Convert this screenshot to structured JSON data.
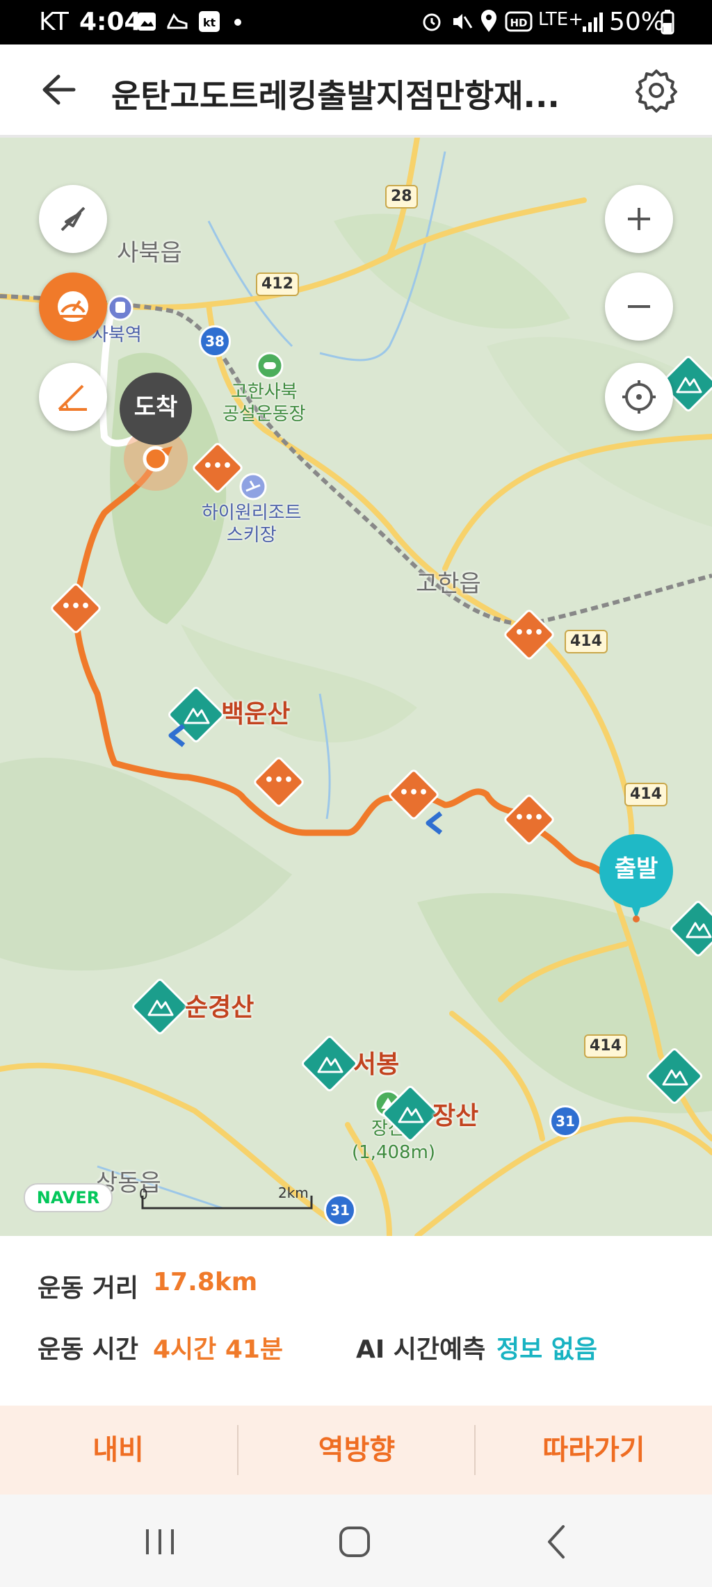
{
  "status_bar": {
    "carrier": "KT",
    "time": "4:04",
    "network": "LTE+",
    "battery": "50%"
  },
  "header": {
    "title": "운탄고도트레킹출발지점만항재..."
  },
  "map": {
    "labels": {
      "sabuk_town": "사북읍",
      "sabuk_station": "사북역",
      "gohan_sabuk_field": "고한사북\n공설운동장",
      "high1_resort": "하이원리조트\n스키장",
      "gohan_town": "고한읍",
      "baegunsan": "백운산",
      "sungyeongsan": "순경산",
      "seobong": "서봉",
      "jangsan": "장산",
      "jangsan_small": "장산",
      "jangsan_elev": "(1,408m)",
      "sangdong_town": "상동읍"
    },
    "roads": {
      "r28": "28",
      "r412": "412",
      "r38": "38",
      "r414a": "414",
      "r414b": "414",
      "r414c": "414",
      "r31a": "31",
      "r31b": "31"
    },
    "pins": {
      "arrive": "도착",
      "start": "출발"
    },
    "scale": {
      "zero": "0",
      "distance": "2km"
    },
    "logo": "NAVER",
    "icons": {
      "zoom_in": "plus-icon",
      "zoom_out": "minus-icon",
      "locate": "crosshair-icon",
      "compass": "compass-off-icon",
      "speed": "speedometer-icon",
      "slope": "slope-icon"
    }
  },
  "info": {
    "distance_label": "운동 거리",
    "distance_value": "17.8km",
    "time_label": "운동 시간",
    "time_value": "4시간 41분",
    "ai_label": "AI 시간예측",
    "ai_value": "정보 없음"
  },
  "actions": {
    "navi": "내비",
    "reverse": "역방향",
    "follow": "따라가기"
  },
  "colors": {
    "route": "#f07a2a",
    "accent_teal": "#18b3c2",
    "action_bg": "#fdeee5"
  }
}
